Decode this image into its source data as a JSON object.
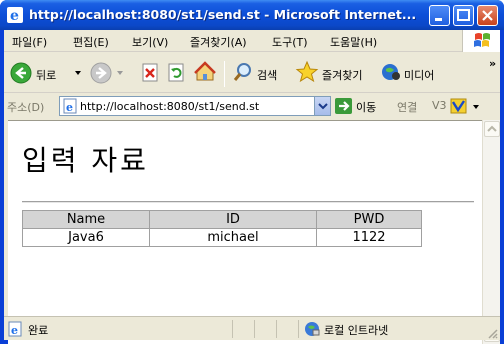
{
  "window": {
    "title": "http://localhost:8080/st1/send.st - Microsoft Internet..."
  },
  "menu": [
    "파일(F)",
    "편집(E)",
    "보기(V)",
    "즐겨찾기(A)",
    "도구(T)",
    "도움말(H)"
  ],
  "toolbar": {
    "back_label": "뒤로",
    "search_label": "검색",
    "favorites_label": "즐겨찾기",
    "media_label": "미디어",
    "overflow": "»"
  },
  "address": {
    "label": "주소(D)",
    "url": "http://localhost:8080/st1/send.st",
    "go_label": "이동",
    "links_label": "연결",
    "v3_label": "V3"
  },
  "page": {
    "title": "입력 자료",
    "table": {
      "headers": [
        "Name",
        "ID",
        "PWD"
      ],
      "rows": [
        [
          "Java6",
          "michael",
          "1122"
        ]
      ]
    }
  },
  "status": {
    "text": "완료",
    "zone": "로컬 인트라넷"
  },
  "colors": {
    "titlebar": "#0c4ed8",
    "chrome": "#ece9d8",
    "table_header": "#d4d4d4"
  }
}
